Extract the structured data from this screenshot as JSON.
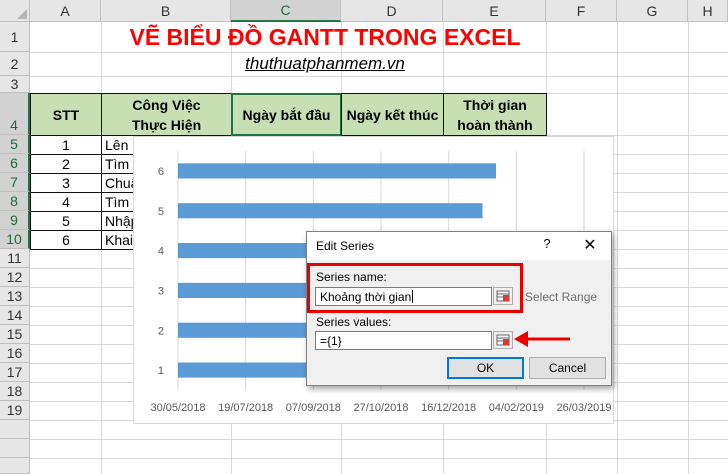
{
  "sheet": {
    "columns": [
      "A",
      "B",
      "C",
      "D",
      "E",
      "F",
      "G",
      "H"
    ],
    "selected_column": "C",
    "rows": [
      "1",
      "2",
      "3",
      "4",
      "5",
      "6",
      "7",
      "8",
      "9",
      "10",
      "11",
      "12",
      "13",
      "14",
      "15",
      "16",
      "17",
      "18",
      "19"
    ],
    "selected_rows": [
      "4",
      "5",
      "6",
      "7",
      "8",
      "9",
      "10"
    ],
    "title": "VẼ BIỂU ĐỒ GANTT TRONG EXCEL",
    "subtitle": "thuthuatphanmem.vn",
    "headers": {
      "stt": "STT",
      "task": "Công Việc\nThực Hiện",
      "start": "Ngày bắt đầu",
      "end": "Ngày kết thúc",
      "duration": "Thời gian\nhoàn thành"
    },
    "table_rows": [
      {
        "stt": "1",
        "task": "Lên"
      },
      {
        "stt": "2",
        "task": "Tìm"
      },
      {
        "stt": "3",
        "task": "Chuẩ"
      },
      {
        "stt": "4",
        "task": "Tìm"
      },
      {
        "stt": "5",
        "task": "Nhập"
      },
      {
        "stt": "6",
        "task": "Khai"
      }
    ]
  },
  "chart_data": {
    "type": "bar",
    "orientation": "horizontal",
    "categories": [
      "1",
      "2",
      "3",
      "4",
      "5",
      "6"
    ],
    "x_ticks": [
      "30/05/2018",
      "19/07/2018",
      "07/09/2018",
      "27/10/2018",
      "16/12/2018",
      "04/02/2019",
      "26/03/2019"
    ],
    "x_tick_values": [
      43250,
      43300,
      43350,
      43400,
      43450,
      43500,
      43550
    ],
    "xlim": [
      43250,
      43550
    ],
    "values": [
      43410,
      43420,
      43430,
      43440,
      43475,
      43485
    ],
    "series_color": "#5b9bd5",
    "grid": true
  },
  "dialog": {
    "title": "Edit Series",
    "help": "?",
    "close": "✕",
    "series_name_label": "Series name:",
    "series_name_value": "Khoảng thời gian",
    "select_range": "Select Range",
    "series_values_label": "Series values:",
    "series_values_value": "={1}",
    "ok": "OK",
    "cancel": "Cancel",
    "highlight_color": "#e60000"
  }
}
